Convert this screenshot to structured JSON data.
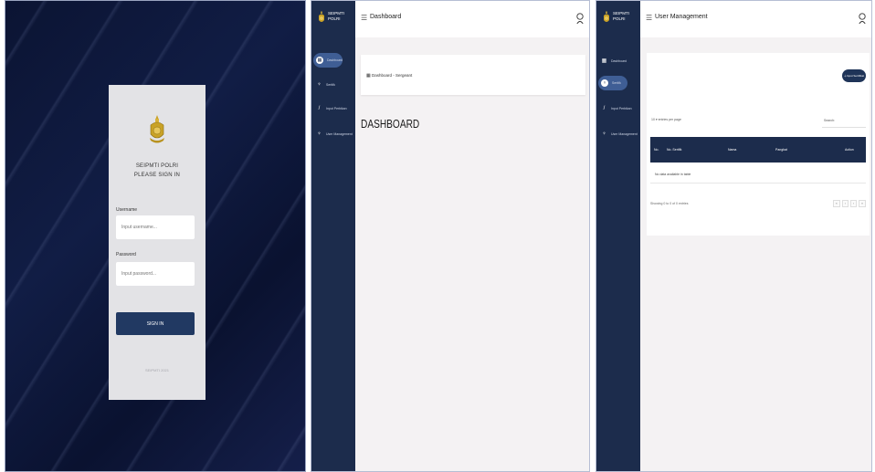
{
  "login": {
    "title_line1": "SEIPMTI POLRI",
    "title_line2": "PLEASE SIGN IN",
    "username_label": "Username",
    "username_placeholder": "Input username...",
    "password_label": "Password",
    "password_placeholder": "Input password...",
    "signin_label": "SIGN IN",
    "footer": "SEIPMTI 2021"
  },
  "dashboard": {
    "brand_line1": "SEIPMTI",
    "brand_line2": "POLRI",
    "page_title": "Dashboard",
    "nav": [
      {
        "label": "Dashboard",
        "icon": "dashboard-icon"
      },
      {
        "label": "Sertifk",
        "icon": "certificate-icon"
      },
      {
        "label": "Input Perbikan",
        "icon": "pen-icon"
      },
      {
        "label": "User Management",
        "icon": "users-icon"
      }
    ],
    "breadcrumb": "Dashboard - Sergeant",
    "heading": "DASHBOARD"
  },
  "user_management": {
    "brand_line1": "SEIPMTI",
    "brand_line2": "POLRI",
    "page_title": "User Management",
    "nav": [
      {
        "label": "Dashboard",
        "icon": "dashboard-icon"
      },
      {
        "label": "Sertifk",
        "icon": "certificate-icon"
      },
      {
        "label": "Input Perbikan",
        "icon": "pen-icon"
      },
      {
        "label": "User Management",
        "icon": "users-icon"
      }
    ],
    "add_button": "Input Sertifikat",
    "show_entries": "10 ▾ entries per page",
    "search_label": "Search:",
    "columns": [
      "No.",
      "No. Sertifk",
      "Nama",
      "Pangkat",
      "Action"
    ],
    "empty_text": "No data available in table",
    "showing_text": "Showing 0 to 0 of 0 entries",
    "pager": [
      "«",
      "‹",
      "›",
      "»"
    ]
  },
  "colors": {
    "sidebar": "#1c2c4c",
    "active_nav": "#3f5e95",
    "button": "#213962",
    "table_header": "#1c2c4c",
    "emblem_gold": "#c9a227"
  }
}
